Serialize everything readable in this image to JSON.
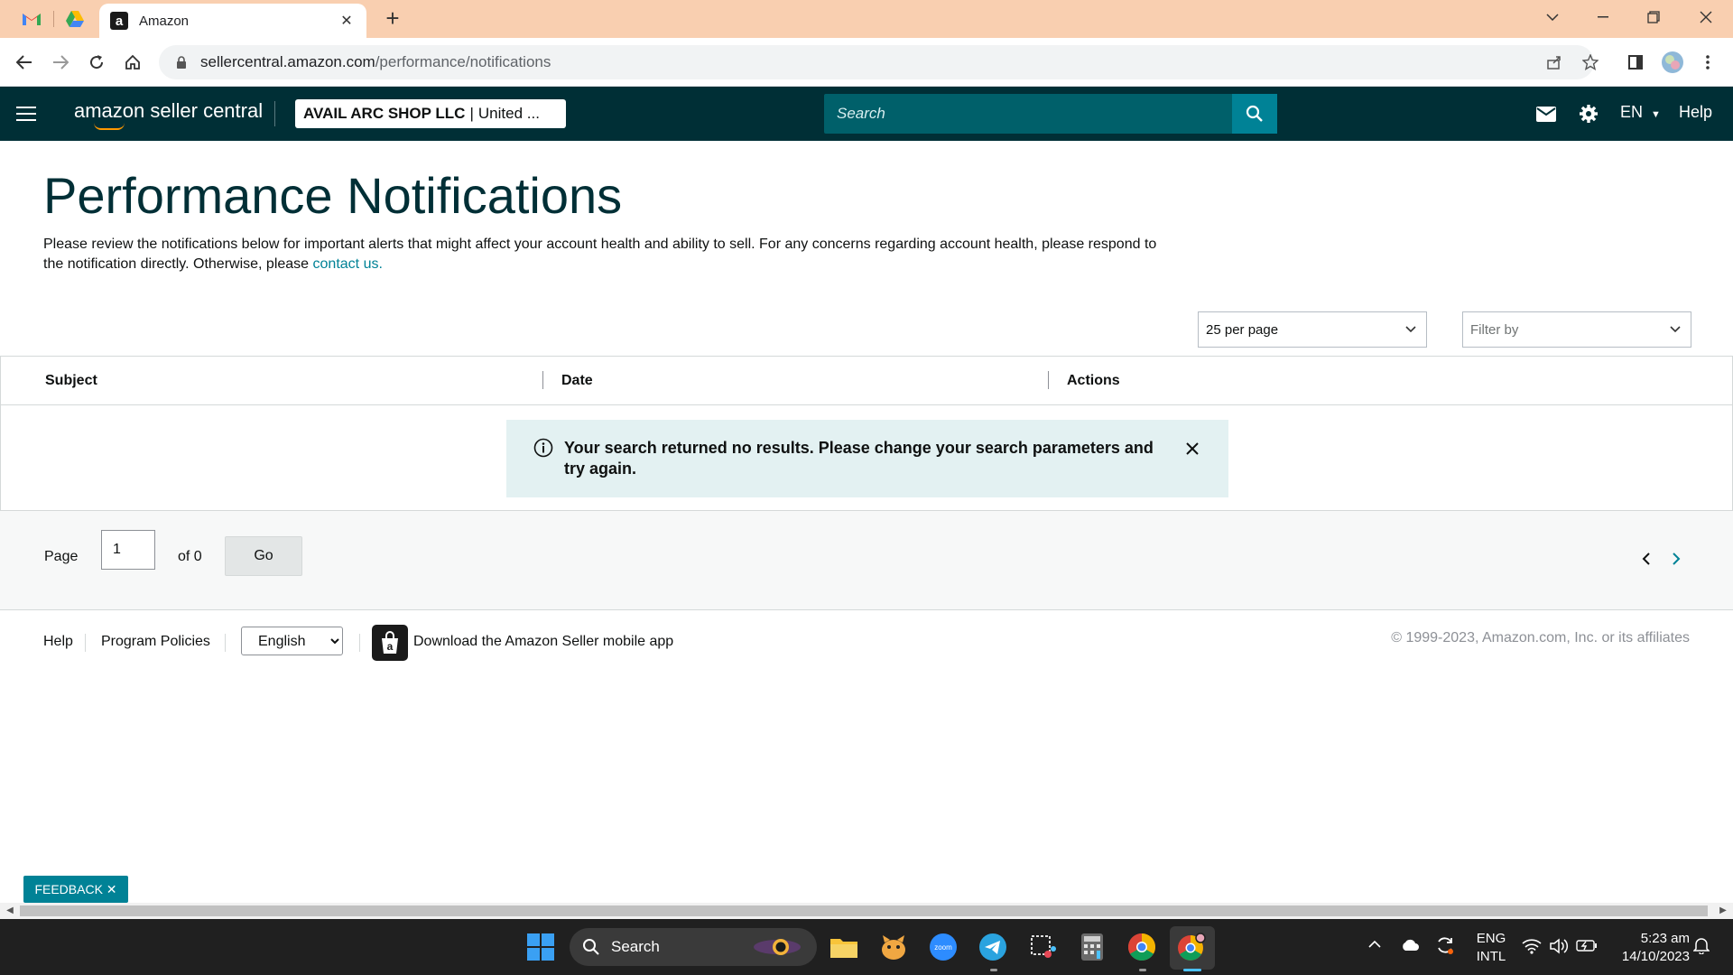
{
  "browser": {
    "tab_title": "Amazon",
    "url_domain": "sellercentral.amazon.com",
    "url_path": "/performance/notifications"
  },
  "header": {
    "logo_text": "amazon seller central",
    "account_name": "AVAIL ARC SHOP LLC",
    "account_region": "United ...",
    "search_placeholder": "Search",
    "language": "EN",
    "help": "Help"
  },
  "page": {
    "title": "Performance Notifications",
    "intro": "Please review the notifications below for important alerts that might affect your account health and ability to sell. For any concerns regarding account health, please respond to the notification directly. Otherwise, please",
    "intro_link": "contact us."
  },
  "filters": {
    "per_page": "25 per page",
    "filter_by": "Filter by"
  },
  "table": {
    "columns": [
      "Subject",
      "Date",
      "Actions"
    ],
    "empty_message": "Your search returned no results. Please change your search parameters and try again."
  },
  "pager": {
    "page_label": "Page",
    "page_value": "1",
    "of_label": "of 0",
    "go_label": "Go"
  },
  "footer": {
    "help": "Help",
    "program_policies": "Program Policies",
    "language_select": "English",
    "app_link": "Download the Amazon Seller mobile app",
    "copyright": "© 1999-2023, Amazon.com, Inc. or its affiliates"
  },
  "feedback": "FEEDBACK ✕",
  "taskbar": {
    "search": "Search",
    "lang_top": "ENG",
    "lang_bottom": "INTL",
    "time": "5:23 am",
    "date": "14/10/2023"
  },
  "colors": {
    "header_bg": "#002f36",
    "accent": "#008296",
    "alert_bg": "#e3f1f2",
    "tabstrip_bg": "#f9cfb0"
  }
}
